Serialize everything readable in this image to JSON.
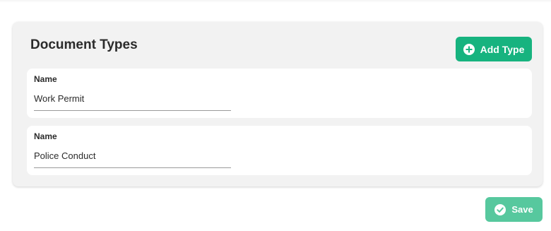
{
  "panel": {
    "title": "Document Types",
    "add_button": {
      "label": "Add Type",
      "icon": "plus-circle-icon"
    }
  },
  "document_types": [
    {
      "field_label": "Name",
      "value": "Work Permit"
    },
    {
      "field_label": "Name",
      "value": "Police Conduct"
    }
  ],
  "save_button": {
    "label": "Save",
    "icon": "check-circle-icon"
  },
  "colors": {
    "primary": "#17b37f",
    "save_disabled": "#57c89e",
    "panel_bg": "#f2f2f2"
  }
}
